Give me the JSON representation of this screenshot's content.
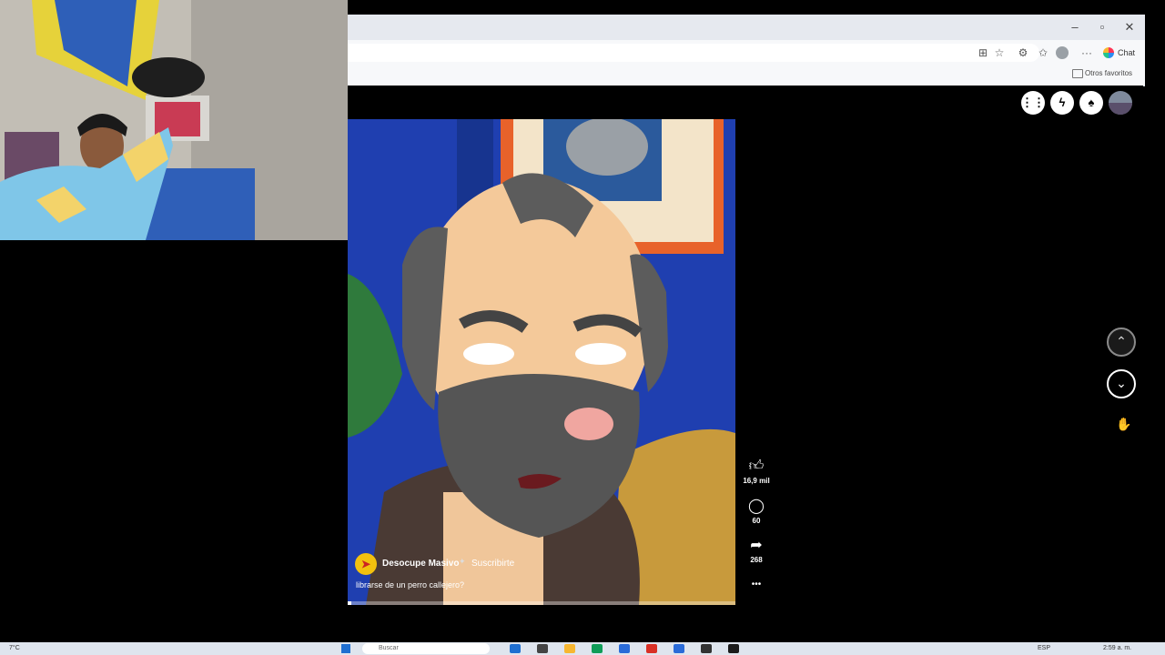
{
  "browser": {
    "window_controls": {
      "minimize": "–",
      "maximize": "▫",
      "close": "✕"
    },
    "toolbar": {
      "chat_label": "Chat",
      "more_label": "···"
    },
    "favorites": {
      "other_favorites": "Otros favoritos"
    }
  },
  "facebook_header": {
    "icons": [
      "menu-grid-icon",
      "messenger-icon",
      "notifications-icon",
      "profile-avatar"
    ]
  },
  "reel": {
    "channel_name": "Desocupe Masivo",
    "subscribe_label": "Suscribirte",
    "caption": "librarse de un perro callejero?",
    "likes": "16,9 mil",
    "comments": "60",
    "shares": "268",
    "more": "•••",
    "progress": 0.01
  },
  "navigation": {
    "prev_glyph": "⌃",
    "next_glyph": "⌄"
  },
  "taskbar": {
    "weather": "7°C",
    "search_placeholder": "Buscar",
    "language": "ESP",
    "time": "2:59 a. m.",
    "app_colors": [
      "#1f6fd1",
      "#444",
      "#f7b731",
      "#0f9d58",
      "#2a6bd8",
      "#d93025",
      "#2a6bd8",
      "#333",
      "#1b1b1b"
    ]
  }
}
